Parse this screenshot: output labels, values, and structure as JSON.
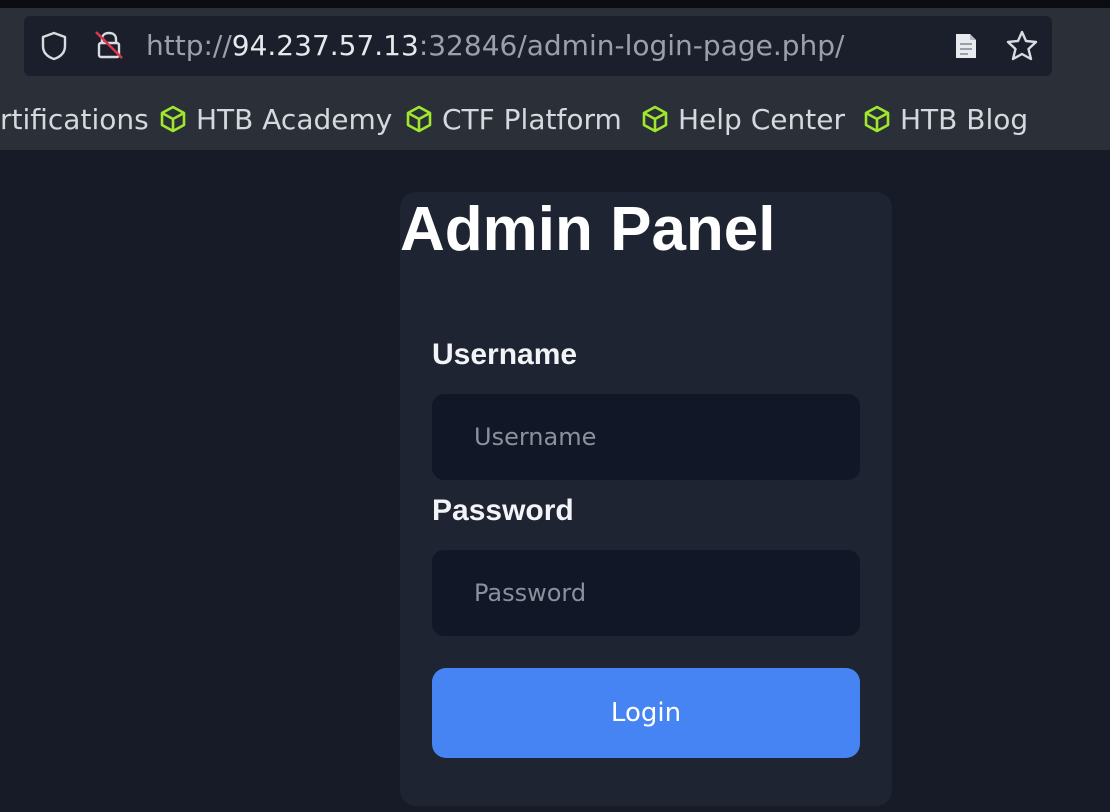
{
  "browser": {
    "url_scheme": "http://",
    "url_host": "94.237.57.13",
    "url_rest": ":32846/admin-login-page.php/",
    "icons": {
      "shield": "shield-icon",
      "lock": "lock-crossed-icon",
      "reader": "reader-view-icon",
      "star": "bookmark-star-icon"
    }
  },
  "bookmarks": [
    {
      "label": "rtifications",
      "icon": null
    },
    {
      "label": "HTB Academy",
      "icon": "cube-icon"
    },
    {
      "label": "CTF Platform",
      "icon": "cube-icon"
    },
    {
      "label": "Help Center",
      "icon": "cube-icon"
    },
    {
      "label": "HTB Blog",
      "icon": "cube-icon"
    }
  ],
  "panel": {
    "title": "Admin Panel",
    "username_label": "Username",
    "username_placeholder": "Username",
    "username_value": "",
    "password_label": "Password",
    "password_placeholder": "Password",
    "password_value": "",
    "login_label": "Login"
  },
  "colors": {
    "page_bg": "#161b27",
    "browser_bg": "#2b2f38",
    "panel_bg": "#1e2431",
    "input_bg": "#111726",
    "button_bg": "#4684f4",
    "bookmark_icon": "#9fe82e"
  }
}
